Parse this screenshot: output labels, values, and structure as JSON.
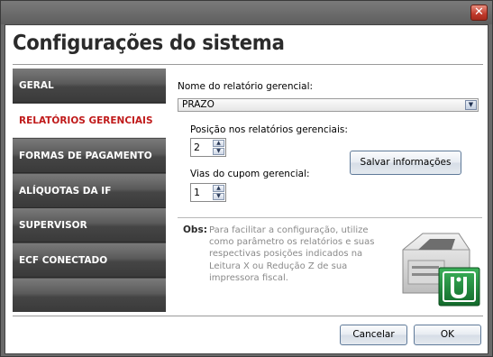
{
  "window": {
    "close_glyph": "✕"
  },
  "page": {
    "title": "Configurações do sistema"
  },
  "sidebar": {
    "items": [
      {
        "label": "GERAL",
        "active": false
      },
      {
        "label": "RELATÓRIOS GERENCIAIS",
        "active": true
      },
      {
        "label": "FORMAS DE PAGAMENTO",
        "active": false
      },
      {
        "label": "ALÍQUOTAS DA IF",
        "active": false
      },
      {
        "label": "SUPERVISOR",
        "active": false
      },
      {
        "label": "ECF CONECTADO",
        "active": false
      }
    ]
  },
  "form": {
    "report_name_label": "Nome do relatório gerencial:",
    "report_name_value": "PRAZO",
    "position_label": "Posição nos relatórios gerenciais:",
    "position_value": "2",
    "copies_label": "Vias do cupom gerencial:",
    "copies_value": "1",
    "save_button": "Salvar informações"
  },
  "obs": {
    "key": "Obs:",
    "lines": [
      "Para facilitar a configuração, utilize",
      "como parâmetro os relatórios e suas",
      "respectivas posições indicados na",
      "Leitura X ou Redução Z de sua",
      "impressora fiscal."
    ]
  },
  "footer": {
    "cancel_button": "Cancelar",
    "ok_button": "OK"
  },
  "colors": {
    "active_item": "#c01b1b",
    "sidebar_bg": "#4a4a4a",
    "logo_green": "#1f8a3a"
  }
}
